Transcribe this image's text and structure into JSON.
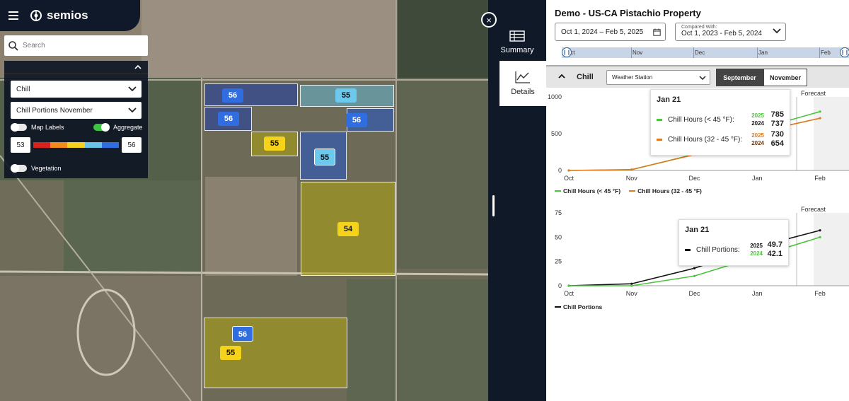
{
  "brand": {
    "name": "semios"
  },
  "search": {
    "placeholder": "Search"
  },
  "map_panel": {
    "metric_select": "Chill",
    "sub_select": "Chill Portions November",
    "toggles": [
      {
        "label": "Map Labels",
        "on": false
      },
      {
        "label": "Aggregate",
        "on": true
      },
      {
        "label": "Vegetation",
        "on": false
      }
    ],
    "range_min": "53",
    "range_max": "56",
    "range_colors": [
      "#d8221e",
      "#f38b1c",
      "#f5d21f",
      "#69c2e8",
      "#2f6de0"
    ]
  },
  "fields": [
    {
      "label": "56",
      "color": "blue"
    },
    {
      "label": "55",
      "color": "light"
    },
    {
      "label": "56",
      "color": "blue"
    },
    {
      "label": "56",
      "color": "blue"
    },
    {
      "label": "55",
      "color": "yellow"
    },
    {
      "label": "55",
      "color": "light"
    },
    {
      "label": "54",
      "color": "yellow"
    },
    {
      "label": "56",
      "color": "blue"
    },
    {
      "label": "55",
      "color": "yellow"
    }
  ],
  "sidenav": {
    "close": "×",
    "summary_label": "Summary",
    "details_label": "Details"
  },
  "right": {
    "title": "Demo - US-CA Pistachio Property",
    "date_range": "Oct 1, 2024 – Feb 5, 2025",
    "compared_label": "Compared With:",
    "compared_value": "Oct 1, 2023 - Feb 5, 2024",
    "timeline_months": [
      "Oct",
      "Nov",
      "Dec",
      "Jan",
      "Feb"
    ],
    "section_name": "Chill",
    "station_select": "Weather Station",
    "segments": {
      "september": "September",
      "november": "November"
    }
  },
  "chart_data": [
    {
      "type": "line",
      "x": [
        "Oct",
        "Nov",
        "Dec",
        "Jan",
        "Feb"
      ],
      "ylim": [
        0,
        1000
      ],
      "yticks": [
        "0",
        "500",
        "1000"
      ],
      "forecast_label": "Forecast",
      "series": [
        {
          "name": "Chill Hours (< 45 °F)",
          "color": "#4cc43d",
          "values": [
            0,
            10,
            220,
            560,
            800
          ]
        },
        {
          "name": "Chill Hours (32 - 45 °F)",
          "color": "#e07a1c",
          "values": [
            0,
            12,
            215,
            520,
            710
          ]
        }
      ],
      "tooltip": {
        "date": "Jan 21",
        "rows": [
          {
            "label": "Chill Hours (< 45 °F):",
            "color": "#4cc43d",
            "years": [
              "2025",
              "2024"
            ],
            "year_colors": [
              "#4cc43d",
              "#1a1a1a"
            ],
            "values": [
              "785",
              "737"
            ]
          },
          {
            "label": "Chill Hours (32 - 45 °F):",
            "color": "#e07a1c",
            "years": [
              "2025",
              "2024"
            ],
            "year_colors": [
              "#e07a1c",
              "#6b3a12"
            ],
            "values": [
              "730",
              "654"
            ]
          }
        ]
      }
    },
    {
      "type": "line",
      "x": [
        "Oct",
        "Nov",
        "Dec",
        "Jan",
        "Feb"
      ],
      "ylim": [
        0,
        75
      ],
      "yticks": [
        "0",
        "25",
        "50",
        "75"
      ],
      "forecast_label": "Forecast",
      "series": [
        {
          "name": "Chill Portions",
          "color": "#111111",
          "values": [
            0,
            2,
            18,
            40,
            57
          ]
        },
        {
          "name": "",
          "color": "#4cc43d",
          "values": [
            0,
            0,
            10,
            30,
            50
          ]
        }
      ],
      "tooltip": {
        "date": "Jan 21",
        "rows": [
          {
            "label": "Chill Portions:",
            "color": "#111111",
            "years": [
              "2025",
              "2024"
            ],
            "year_colors": [
              "#111111",
              "#4cc43d"
            ],
            "values": [
              "49.7",
              "42.1"
            ]
          }
        ]
      }
    }
  ]
}
